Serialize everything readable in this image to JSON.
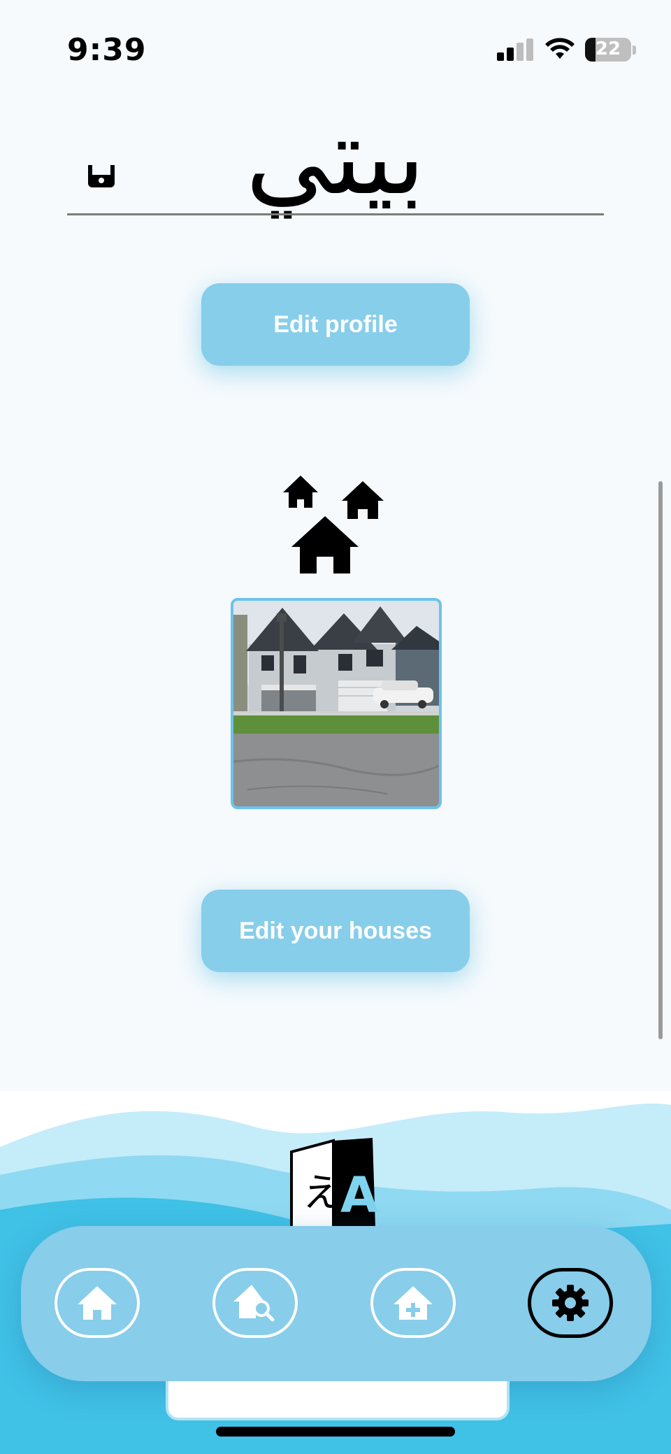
{
  "status_bar": {
    "time": "9:39",
    "battery": "22",
    "icons": [
      "cellular-signal-icon",
      "wifi-icon",
      "battery-icon"
    ]
  },
  "header": {
    "logo_text": "بيتي",
    "icons": [
      "profile-small-icon"
    ]
  },
  "profile": {
    "edit_profile_label": "Edit profile"
  },
  "houses": {
    "icon": "houses-icon",
    "edit_houses_label": "Edit your houses"
  },
  "footer": {
    "language_icon": "language-translate-icon"
  },
  "nav": {
    "items": [
      {
        "name": "home",
        "icon": "home-icon",
        "active": false
      },
      {
        "name": "search-house",
        "icon": "house-search-icon",
        "active": false
      },
      {
        "name": "add-house",
        "icon": "house-add-icon",
        "active": false
      },
      {
        "name": "settings",
        "icon": "gear-icon",
        "active": true
      }
    ]
  },
  "colors": {
    "accent": "#87ceea",
    "background": "#f6fafd",
    "wave_dark": "#3fc1e5",
    "wave_light": "#c5ecf9"
  }
}
